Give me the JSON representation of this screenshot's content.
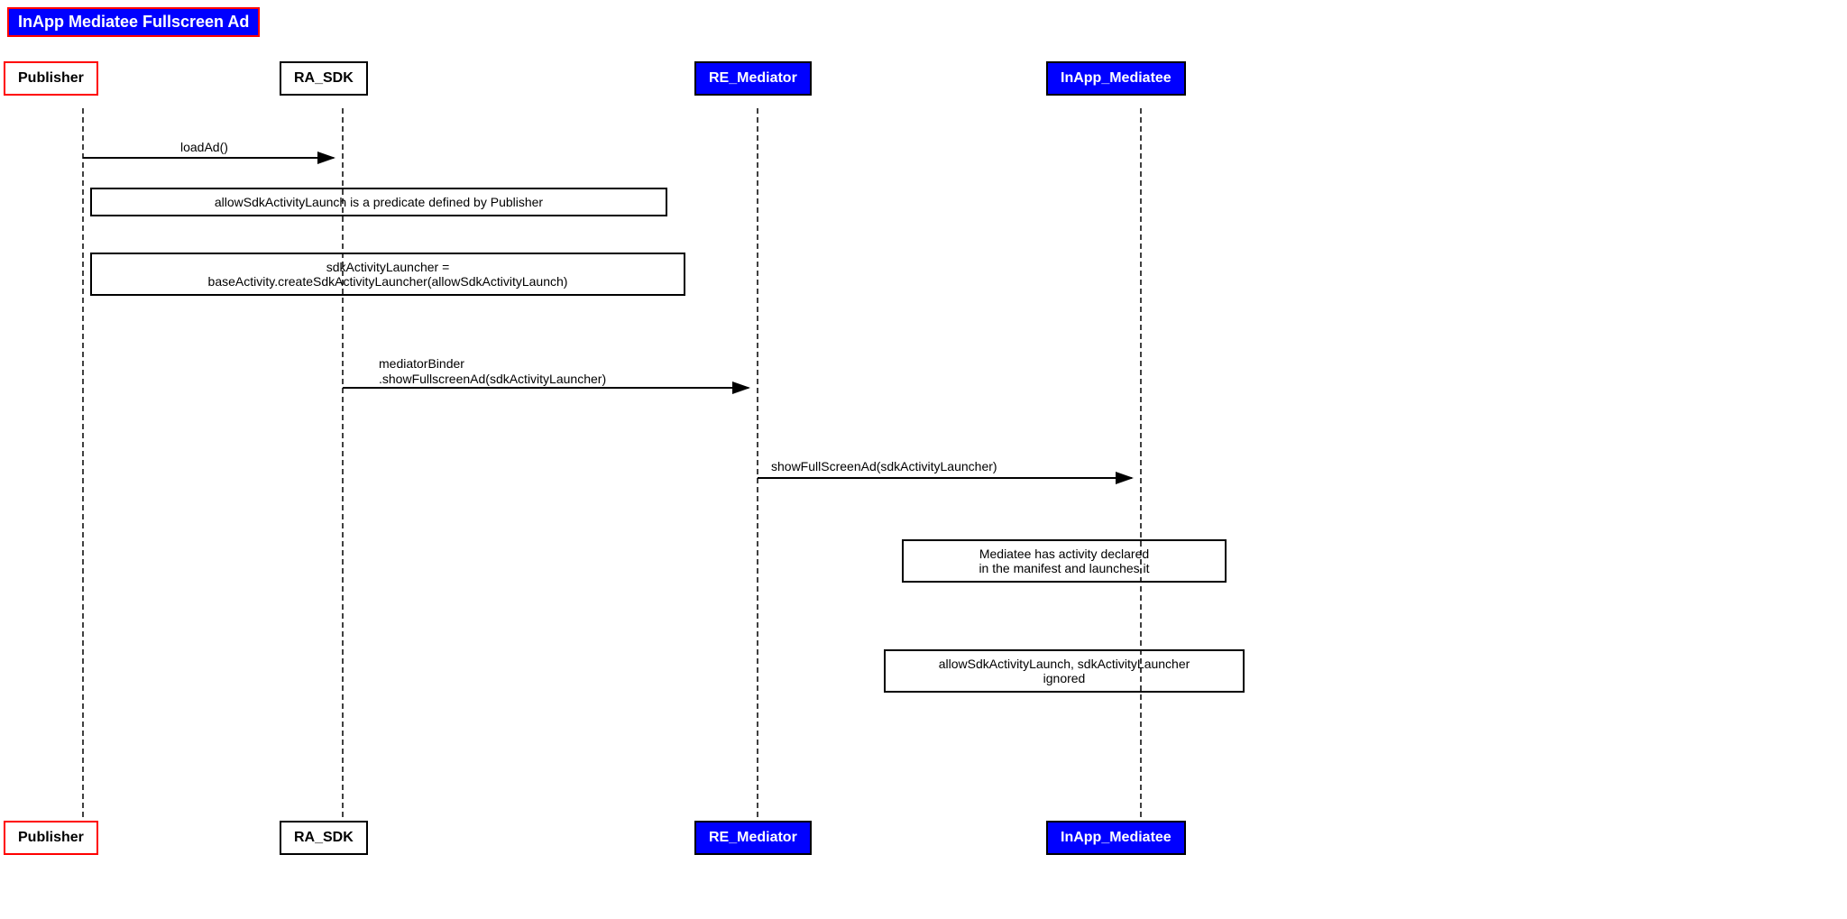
{
  "title": "InApp Mediatee Fullscreen Ad",
  "participants": {
    "publisher": "Publisher",
    "ra_sdk": "RA_SDK",
    "re_mediator": "RE_Mediator",
    "inapp_mediatee": "InApp_Mediatee"
  },
  "messages": {
    "loadAd": "loadAd()",
    "allowSdkNote": "allowSdkActivityLaunch is a predicate defined by Publisher",
    "sdkActivityLauncher": "sdkActivityLauncher =\nbaseActivity.createSdkActivityLauncher(allowSdkActivityLaunch)",
    "mediatorBinder": "mediatorBinder\n.showFullscreenAd(sdkActivityLauncher)",
    "showFullScreenAd": "showFullScreenAd(sdkActivityLauncher)",
    "mediateeNote": "Mediatee has activity declared\nin the manifest and launches it",
    "allowSdkIgnored": "allowSdkActivityLaunch, sdkActivityLauncher\nignored"
  }
}
